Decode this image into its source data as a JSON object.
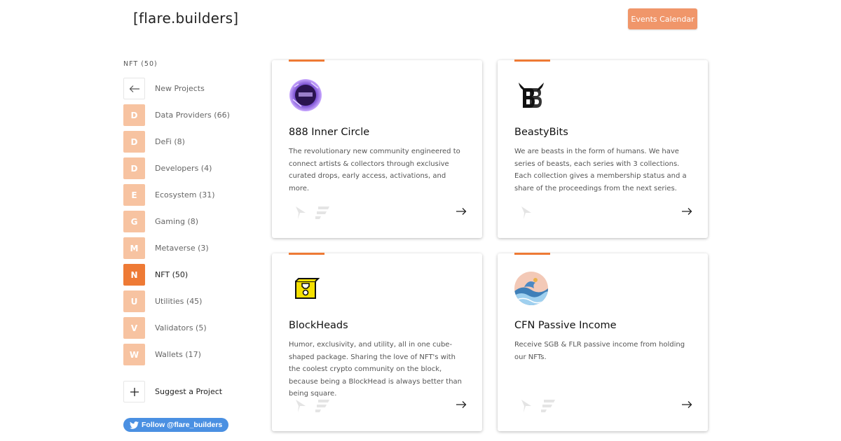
{
  "header": {
    "logo": "[flare.builders]",
    "events_button": "Events Calendar"
  },
  "sidebar": {
    "title": "NFT (50)",
    "back_label": "New Projects",
    "items": [
      {
        "letter": "D",
        "label": "Data Providers (66)",
        "active": false
      },
      {
        "letter": "D",
        "label": "DeFi (8)",
        "active": false
      },
      {
        "letter": "D",
        "label": "Developers (4)",
        "active": false
      },
      {
        "letter": "E",
        "label": "Ecosystem (31)",
        "active": false
      },
      {
        "letter": "G",
        "label": "Gaming (8)",
        "active": false
      },
      {
        "letter": "M",
        "label": "Metaverse (3)",
        "active": false
      },
      {
        "letter": "N",
        "label": "NFT (50)",
        "active": true
      },
      {
        "letter": "U",
        "label": "Utilities (45)",
        "active": false
      },
      {
        "letter": "V",
        "label": "Validators (5)",
        "active": false
      },
      {
        "letter": "W",
        "label": "Wallets (17)",
        "active": false
      }
    ],
    "suggest_label": "Suggest a Project",
    "twitter_label": "Follow @flare_builders"
  },
  "cards": [
    {
      "title": "888 Inner Circle",
      "description": "The revolutionary new community engineered to connect artists & collectors through exclusive curated drops, early access, activations, and more.",
      "networks": [
        "flare",
        "songbird"
      ]
    },
    {
      "title": "BeastyBits",
      "description": "We are beasts in the form of humans. We have series of beasts, each series with 3 collections. Each collection gives a membership status and a share of the proceedings from the next series.",
      "networks": [
        "flare"
      ]
    },
    {
      "title": "BlockHeads",
      "description": "Humor, exclusivity, and utility, all in one cube-shaped package. Sharing the love of NFT's with the coolest crypto community on the block, because being a BlockHead is always better than being square.",
      "networks": [
        "flare",
        "songbird"
      ]
    },
    {
      "title": "CFN Passive Income",
      "description": "Receive SGB & FLR passive income from holding our NFTs.",
      "networks": [
        "flare",
        "songbird"
      ]
    }
  ],
  "colors": {
    "accent": "#ee7a35",
    "badge": "#f7c3a1",
    "button": "#f0966a",
    "twitter": "#4a90e2"
  }
}
